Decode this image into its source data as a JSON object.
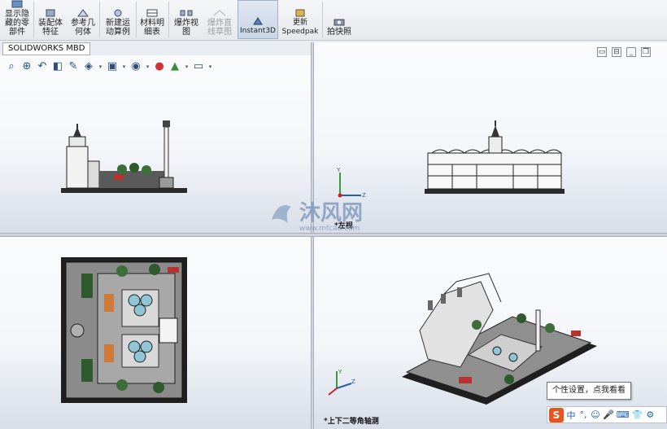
{
  "ribbon": {
    "buttons": [
      {
        "label": "显示隐\n藏的零\n部件"
      },
      {
        "label": "装配体\n特征"
      },
      {
        "label": "参考几\n何体"
      },
      {
        "label": "新建运\n动算例"
      },
      {
        "label": "材料明\n细表"
      },
      {
        "label": "爆炸视\n图"
      },
      {
        "label": "爆炸直\n线草图"
      },
      {
        "label": "Instant3D"
      },
      {
        "label": "更新\nSpeedpak"
      },
      {
        "label": "拍快照"
      }
    ]
  },
  "tab": {
    "label": "SOLIDWORKS MBD"
  },
  "hud_icons": [
    "zoom-to-fit-icon",
    "zoom-area-icon",
    "previous-view-icon",
    "section-view-icon",
    "dynamic-annotation-icon",
    "view-orientation-icon",
    "display-style-icon",
    "hide-show-icon",
    "edit-appearance-icon",
    "apply-scene-icon",
    "view-settings-icon"
  ],
  "viewports": {
    "left_view_label": "*左视",
    "iso_view_label": "*上下二等角轴测"
  },
  "watermark": {
    "brand": "沐风网",
    "url": "www.mfcad.com"
  },
  "tooltip": {
    "text": "个性设置，点我看看"
  },
  "ime": {
    "items": [
      "中",
      "°,",
      "☺",
      "🎤",
      "⌨",
      "👕",
      "⚙"
    ]
  },
  "colors": {
    "accent": "#1c5fb0",
    "model_dark": "#2a2a2a",
    "grass": "#3d6e3a",
    "ime_logo": "#e8541c"
  }
}
